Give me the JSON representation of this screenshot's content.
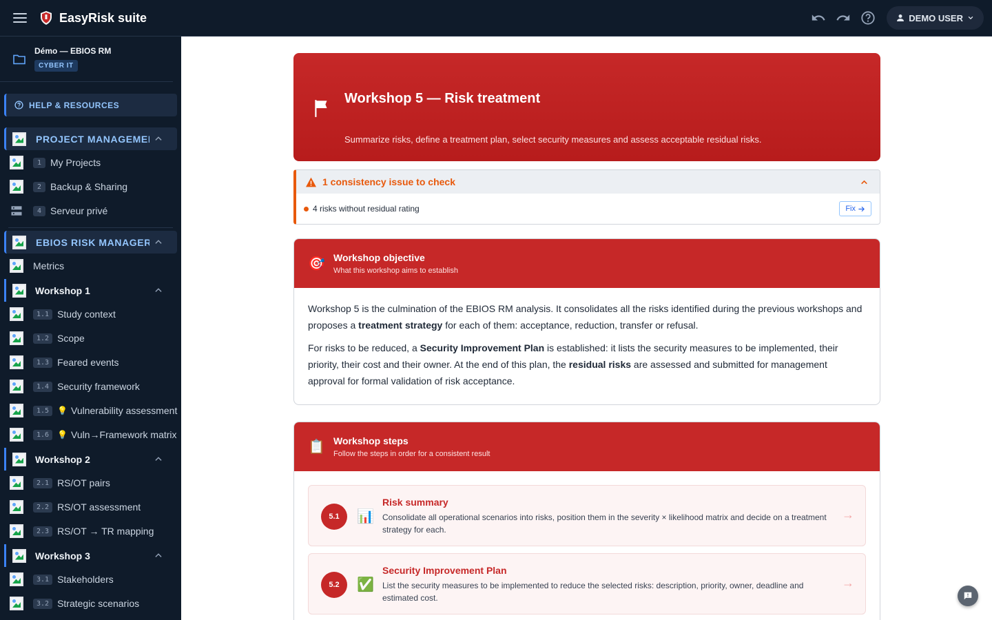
{
  "app": {
    "title": "EasyRisk suite"
  },
  "topbar": {
    "user_label": "DEMO USER"
  },
  "sidebar": {
    "project_name": "Démo — EBIOS RM",
    "project_tag": "CYBER IT",
    "help_label": "HELP & RESOURCES",
    "section1": "PROJECT MANAGEMEN",
    "pm_items": [
      {
        "num": "1",
        "label": "My Projects"
      },
      {
        "num": "2",
        "label": "Backup & Sharing"
      },
      {
        "num": "4",
        "label": "Serveur privé"
      }
    ],
    "section2": "EBIOS RISK MANAGER",
    "metrics_label": "Metrics",
    "w1_label": "Workshop 1",
    "w1_items": [
      {
        "num": "1.1",
        "label": "Study context"
      },
      {
        "num": "1.2",
        "label": "Scope"
      },
      {
        "num": "1.3",
        "label": "Feared events"
      },
      {
        "num": "1.4",
        "label": "Security framework"
      },
      {
        "num": "1.5",
        "label": "Vulnerability assessment"
      },
      {
        "num": "1.6",
        "label": "Vuln→Framework matrix"
      }
    ],
    "w2_label": "Workshop 2",
    "w2_items": [
      {
        "num": "2.1",
        "label": "RS/OT pairs"
      },
      {
        "num": "2.2",
        "label": "RS/OT assessment"
      },
      {
        "num": "2.3",
        "label": "RS/OT → TR mapping"
      }
    ],
    "w3_label": "Workshop 3",
    "w3_items": [
      {
        "num": "3.1",
        "label": "Stakeholders"
      },
      {
        "num": "3.2",
        "label": "Strategic scenarios"
      }
    ]
  },
  "hero": {
    "title": "Workshop 5 — Risk treatment",
    "subtitle": "Summarize risks, define a treatment plan, select security measures and assess acceptable residual risks."
  },
  "consistency": {
    "title": "1 consistency issue to check",
    "issue_text": "4 risks without residual rating",
    "fix_label": "Fix"
  },
  "objective": {
    "title": "Workshop objective",
    "subtitle": "What this workshop aims to establish",
    "p1_a": "Workshop 5 is the culmination of the EBIOS RM analysis. It consolidates all the risks identified during the previous workshops and proposes a ",
    "p1_b": "treatment strategy",
    "p1_c": " for each of them: acceptance, reduction, transfer or refusal.",
    "p2_a": "For risks to be reduced, a ",
    "p2_b": "Security Improvement Plan",
    "p2_c": " is established: it lists the security measures to be implemented, their priority, their cost and their owner. At the end of this plan, the ",
    "p2_d": "residual risks",
    "p2_e": " are assessed and submitted for management approval for formal validation of risk acceptance."
  },
  "steps": {
    "title": "Workshop steps",
    "subtitle": "Follow the steps in order for a consistent result",
    "items": [
      {
        "num": "5.1",
        "icon": "chart-icon",
        "title": "Risk summary",
        "desc": "Consolidate all operational scenarios into risks, position them in the severity × likelihood matrix and decide on a treatment strategy for each."
      },
      {
        "num": "5.2",
        "icon": "check-icon",
        "title": "Security Improvement Plan",
        "desc": "List the security measures to be implemented to reduce the selected risks: description, priority, owner, deadline and estimated cost."
      }
    ]
  }
}
